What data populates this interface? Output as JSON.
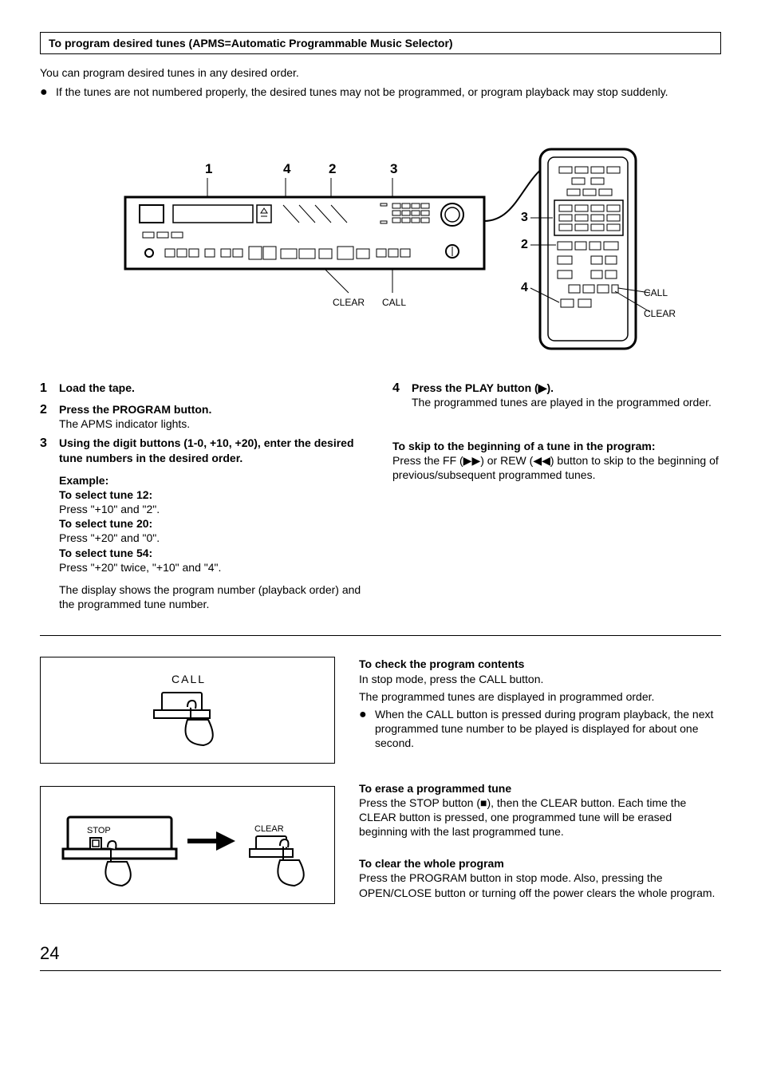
{
  "title": "To program desired tunes (APMS=Automatic Programmable Music Selector)",
  "intro": "You can program desired tunes in any desired order.",
  "note_bullet": "If the tunes are not numbered properly, the desired tunes may not be programmed, or program playback may stop suddenly.",
  "diagram": {
    "callouts_top": [
      "1",
      "4",
      "2",
      "3"
    ],
    "callouts_bottom": [
      "CLEAR",
      "CALL"
    ],
    "remote_callouts": [
      "3",
      "2",
      "4"
    ],
    "remote_labels": [
      "CALL",
      "CLEAR"
    ]
  },
  "steps": {
    "s1_num": "1",
    "s1_head": "Load the tape.",
    "s2_num": "2",
    "s2_head": "Press the PROGRAM button.",
    "s2_sub": "The APMS indicator lights.",
    "s3_num": "3",
    "s3_head": "Using the digit buttons (1-0, +10, +20), enter the desired tune numbers in the desired order.",
    "example_label": "Example:",
    "ex1_head": "To select tune 12:",
    "ex1_body": "Press \"+10\" and \"2\".",
    "ex2_head": "To select tune 20:",
    "ex2_body": "Press \"+20\" and \"0\".",
    "ex3_head": "To select tune 54:",
    "ex3_body": "Press \"+20\" twice, \"+10\" and \"4\".",
    "s3_tail": "The display shows the program number (playback order) and the programmed tune number.",
    "s4_num": "4",
    "s4_head": "Press the PLAY button (▶).",
    "s4_sub": "The programmed tunes are played in the programmed order.",
    "skip_head": "To skip to the beginning of a tune in the program:",
    "skip_body": "Press the FF (▶▶) or REW (◀◀) button to skip to the beginning of previous/subsequent programmed tunes."
  },
  "illus": {
    "call_label": "CALL",
    "stop_label": "STOP",
    "clear_label": "CLEAR"
  },
  "check": {
    "head": "To check the program contents",
    "l1": "In stop mode, press the CALL button.",
    "l2": "The programmed tunes are displayed in programmed order.",
    "bullet": "When the CALL button is pressed during program playback, the next programmed tune number to be played is displayed for about one second."
  },
  "erase": {
    "head": "To erase a programmed tune",
    "body": "Press the STOP button (■), then the CLEAR button. Each time the CLEAR button is pressed, one programmed tune will be erased beginning with the last programmed tune."
  },
  "clearall": {
    "head": "To clear the whole program",
    "body": "Press the PROGRAM button in stop mode.  Also, pressing the OPEN/CLOSE button or turning off the power clears the whole program."
  },
  "page": "24"
}
